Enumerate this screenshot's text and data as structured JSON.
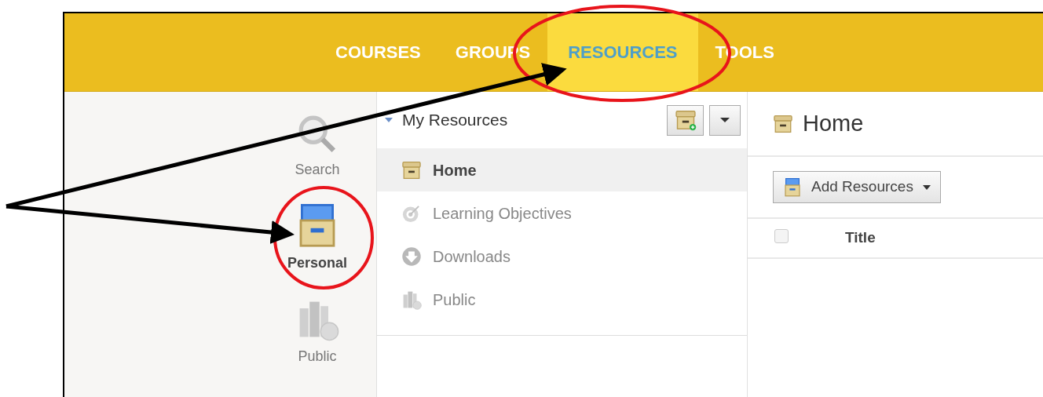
{
  "nav": {
    "tabs": [
      {
        "label": "COURSES",
        "selected": false
      },
      {
        "label": "GROUPS",
        "selected": false
      },
      {
        "label": "RESOURCES",
        "selected": true
      },
      {
        "label": "TOOLS",
        "selected": false
      }
    ]
  },
  "sidebar": {
    "items": [
      {
        "label": "Search",
        "kind": "search",
        "selected": false
      },
      {
        "label": "Personal",
        "kind": "personal",
        "selected": true
      },
      {
        "label": "Public",
        "kind": "public",
        "selected": false
      }
    ]
  },
  "tree": {
    "title": "My Resources",
    "expanded": true,
    "items": [
      {
        "label": "Home",
        "kind": "home",
        "selected": true
      },
      {
        "label": "Learning Objectives",
        "kind": "objectives",
        "selected": false
      },
      {
        "label": "Downloads",
        "kind": "downloads",
        "selected": false
      },
      {
        "label": "Public",
        "kind": "public",
        "selected": false
      }
    ]
  },
  "content": {
    "title": "Home",
    "add_button": "Add Resources",
    "table": {
      "select_all_checked": false,
      "columns": [
        "Title"
      ]
    }
  }
}
